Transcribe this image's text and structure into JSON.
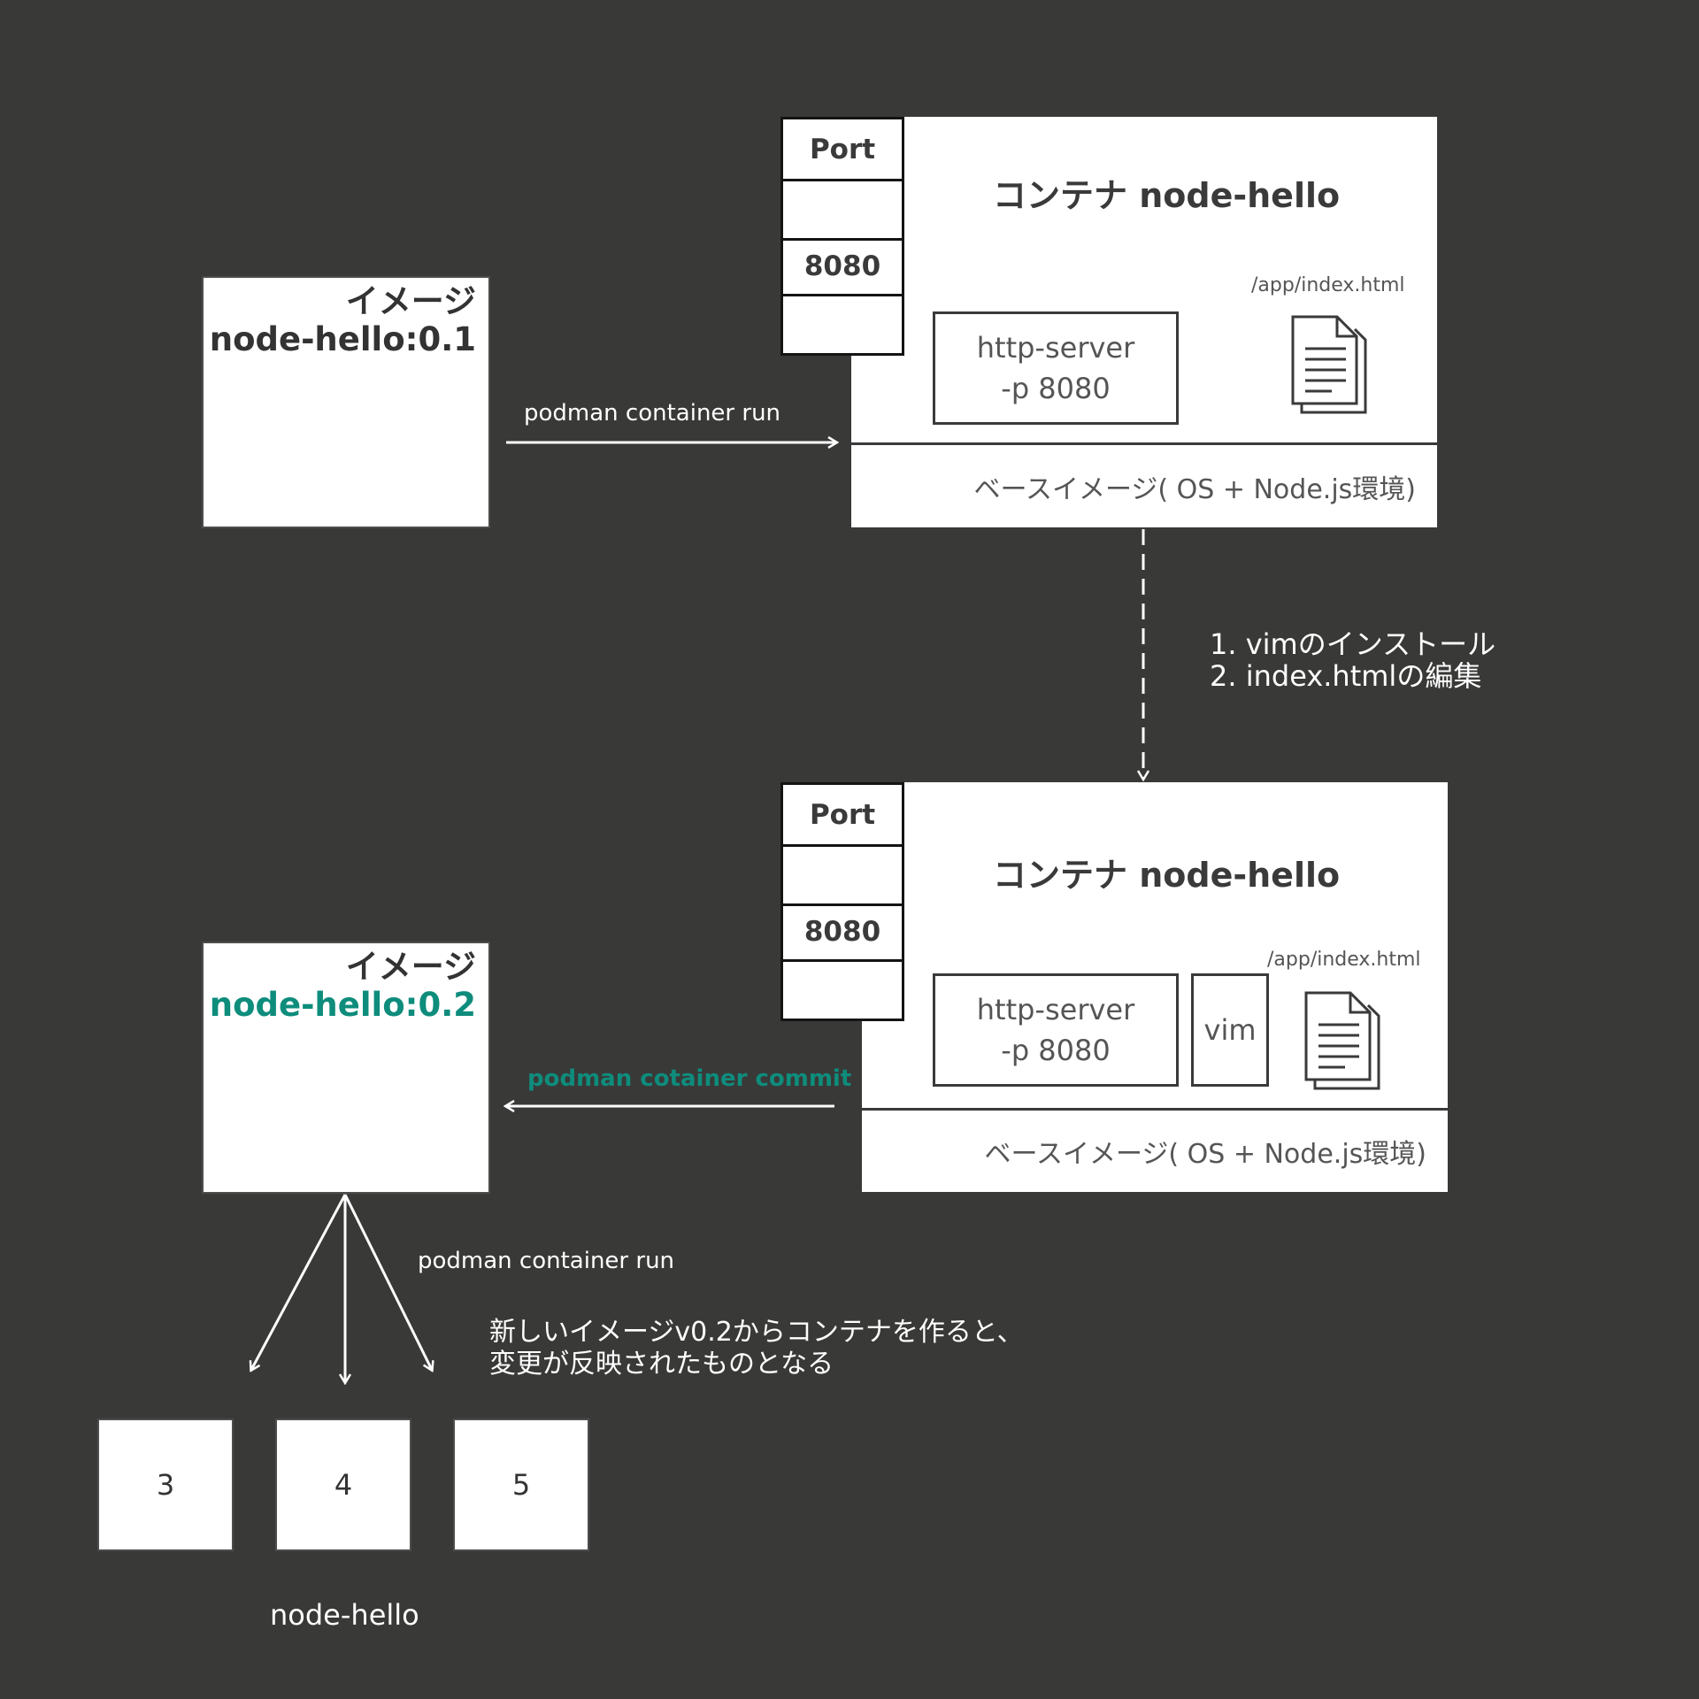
{
  "colors": {
    "background": "#393938",
    "box": "#ffffff",
    "accent": "#0e8c7c",
    "text": "#333333"
  },
  "image_v01": {
    "line1": "イメージ",
    "line2": "node-hello:0.1"
  },
  "image_v02": {
    "line1": "イメージ",
    "line2": "node-hello:0.2"
  },
  "container_top": {
    "title": "コンテナ node-hello",
    "port_header": "Port",
    "port_value": "8080",
    "process_line1": "http-server",
    "process_line2": "-p 8080",
    "file_path": "/app/index.html",
    "file_icon": "document-icon",
    "base_layer": "ベースイメージ( OS + Node.js環境)"
  },
  "container_bottom": {
    "title": "コンテナ node-hello",
    "port_header": "Port",
    "port_value": "8080",
    "process_line1": "http-server",
    "process_line2": "-p 8080",
    "extra_process": "vim",
    "file_path": "/app/index.html",
    "file_icon": "document-icon",
    "base_layer": "ベースイメージ( OS + Node.js環境)"
  },
  "arrows": {
    "run_top": "podman container run",
    "steps": [
      "1. vimのインストール",
      "2. index.htmlの編集"
    ],
    "commit": "podman cotainer commit",
    "run_bottom": "podman container run"
  },
  "note": {
    "line1": "新しいイメージv0.2からコンテナを作ると、",
    "line2": "変更が反映されたものとなる"
  },
  "new_containers": {
    "items": [
      "3",
      "4",
      "5"
    ],
    "caption": "node-hello"
  }
}
